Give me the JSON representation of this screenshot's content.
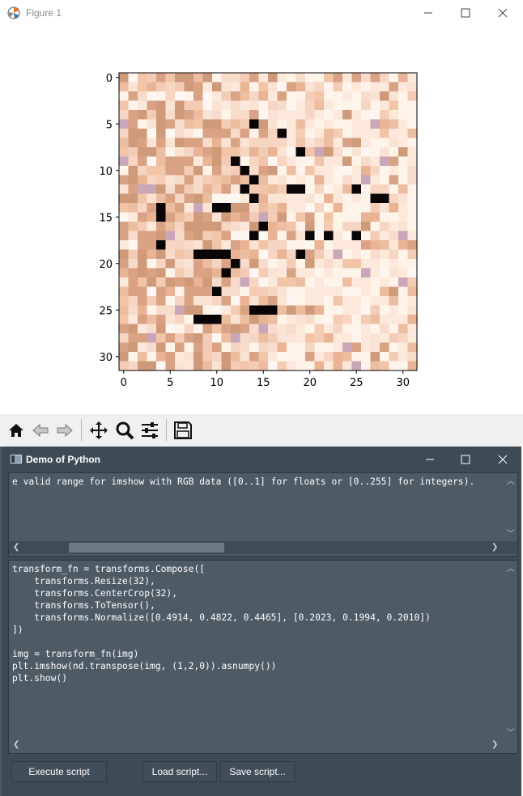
{
  "figure_window": {
    "title": "Figure 1",
    "toolbar": [
      "home-icon",
      "back-icon",
      "forward-icon",
      "pan-icon",
      "zoom-icon",
      "configure-subplots-icon",
      "save-icon"
    ]
  },
  "chart_data": {
    "type": "heatmap",
    "title": "",
    "xlabel": "",
    "ylabel": "",
    "x_ticks": [
      "0",
      "5",
      "10",
      "15",
      "20",
      "25",
      "30"
    ],
    "y_ticks": [
      "0",
      "5",
      "10",
      "15",
      "20",
      "25",
      "30"
    ],
    "xlim": [
      -0.5,
      31.5
    ],
    "ylim": [
      31.5,
      -0.5
    ],
    "grid": false,
    "description_values": "32x32 RGB image, mostly skin/peach tones with scattered near-black pixels",
    "dark_pixels": [
      [
        14,
        5
      ],
      [
        17,
        6
      ],
      [
        19,
        8
      ],
      [
        12,
        9
      ],
      [
        13,
        10
      ],
      [
        14,
        11
      ],
      [
        13,
        12
      ],
      [
        18,
        12
      ],
      [
        19,
        12
      ],
      [
        25,
        12
      ],
      [
        27,
        13
      ],
      [
        28,
        13
      ],
      [
        14,
        13
      ],
      [
        4,
        14
      ],
      [
        10,
        14
      ],
      [
        11,
        14
      ],
      [
        4,
        15
      ],
      [
        15,
        16
      ],
      [
        14,
        17
      ],
      [
        20,
        17
      ],
      [
        22,
        17
      ],
      [
        25,
        17
      ],
      [
        4,
        18
      ],
      [
        8,
        19
      ],
      [
        9,
        19
      ],
      [
        10,
        19
      ],
      [
        11,
        19
      ],
      [
        19,
        19
      ],
      [
        12,
        20
      ],
      [
        11,
        21
      ],
      [
        10,
        23
      ],
      [
        14,
        25
      ],
      [
        15,
        25
      ],
      [
        16,
        25
      ],
      [
        8,
        26
      ],
      [
        9,
        26
      ],
      [
        10,
        26
      ]
    ],
    "colors": {
      "base": "#f6d5c2",
      "dark": "#0a0608",
      "light": "#fff4ea",
      "tan": "#cf9a7a"
    }
  },
  "demo_window": {
    "title": "Demo of Python",
    "output_text": "e valid range for imshow with RGB data ([0..1] for floats or [0..255] for integers).",
    "script_text": "transform_fn = transforms.Compose([\n    transforms.Resize(32),\n    transforms.CenterCrop(32),\n    transforms.ToTensor(),\n    transforms.Normalize([0.4914, 0.4822, 0.4465], [0.2023, 0.1994, 0.2010])\n])\n\nimg = transform_fn(img)\nplt.imshow(nd.transpose(img, (1,2,0)).asnumpy())\nplt.show()",
    "buttons": {
      "execute": "Execute script",
      "load": "Load script...",
      "save": "Save script..."
    }
  }
}
